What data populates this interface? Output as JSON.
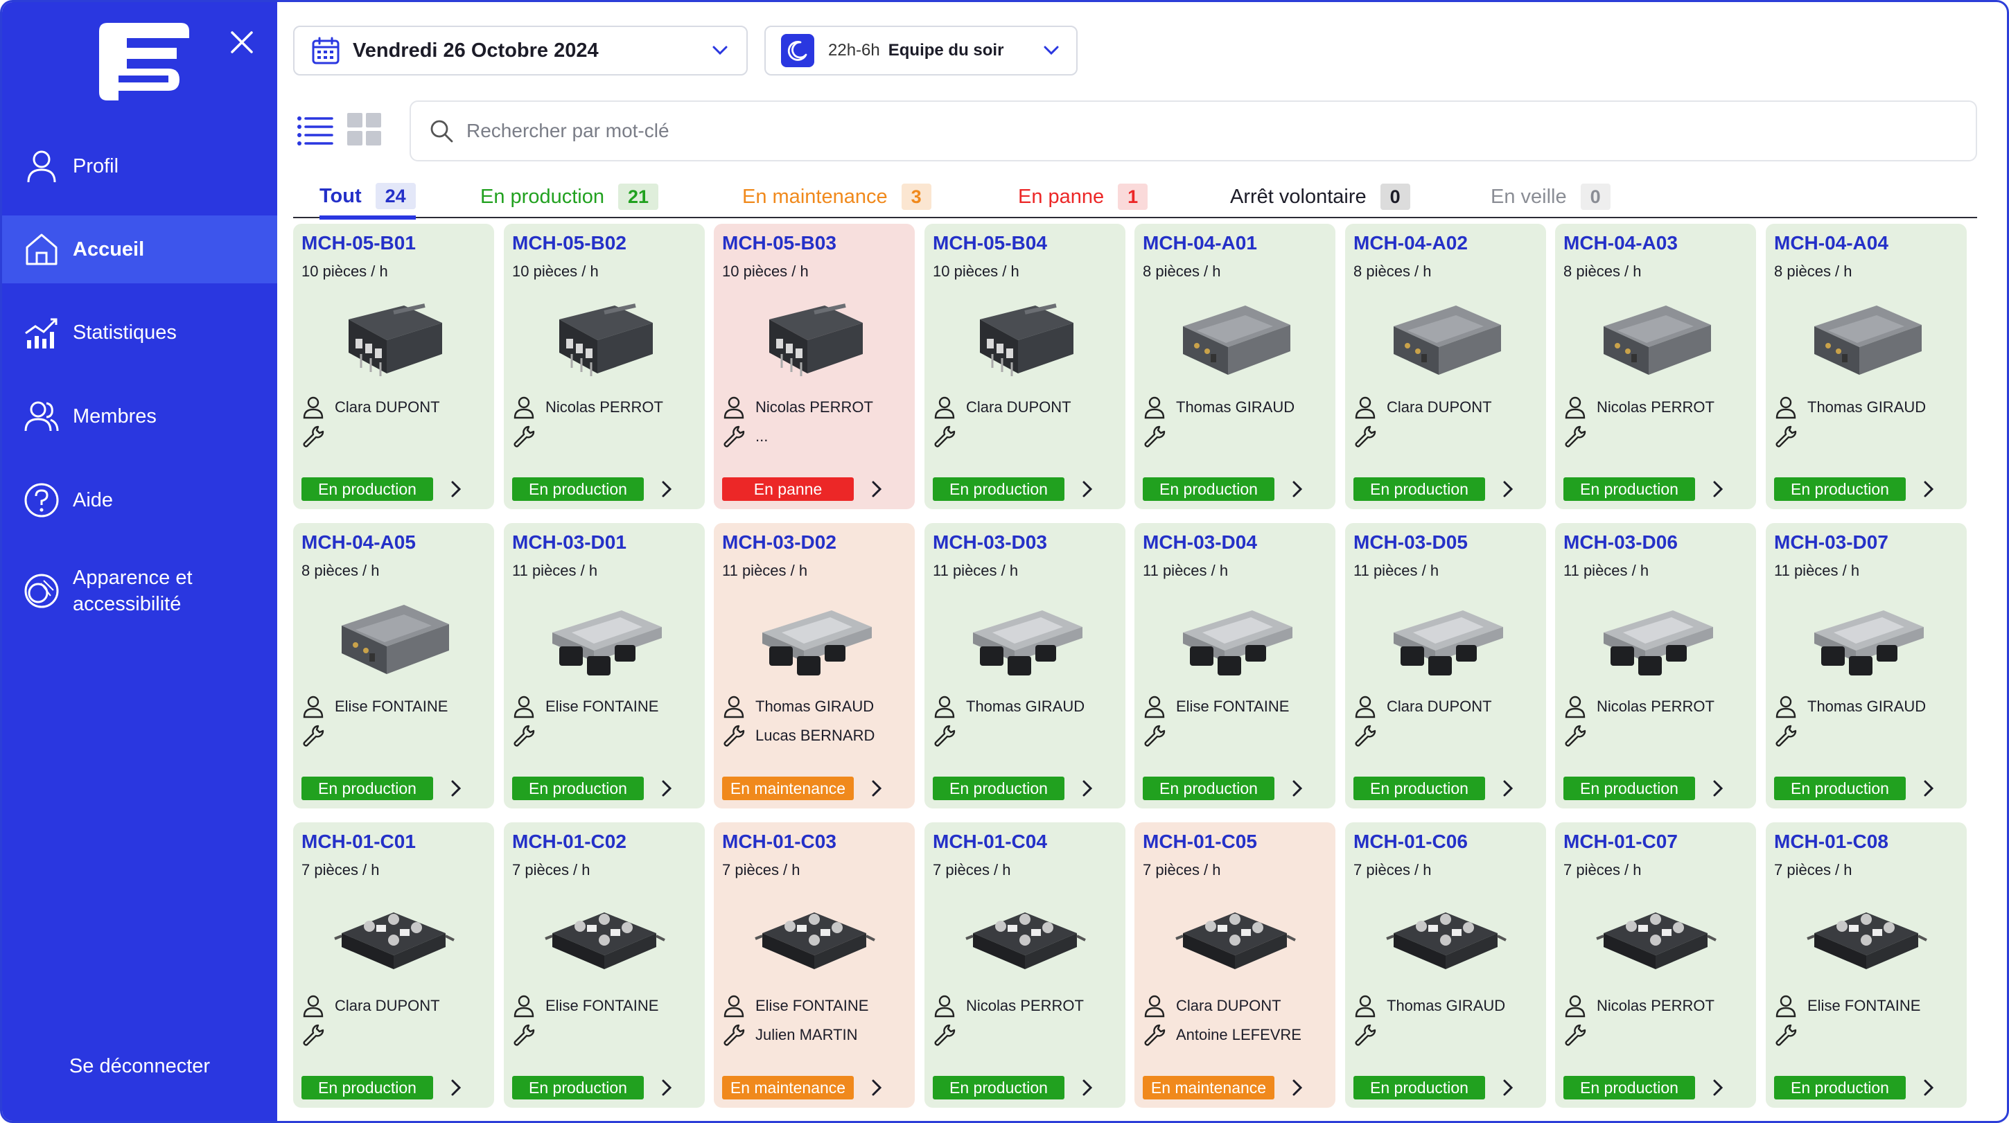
{
  "sidebar": {
    "logo": "logo-icon",
    "items": [
      {
        "label": "Profil",
        "icon": "user-icon"
      },
      {
        "label": "Accueil",
        "icon": "home-icon",
        "active": true
      },
      {
        "label": "Statistiques",
        "icon": "chart-icon"
      },
      {
        "label": "Membres",
        "icon": "members-icon"
      },
      {
        "label": "Aide",
        "icon": "help-icon"
      },
      {
        "label": "Apparence et accessibilité",
        "icon": "appearance-icon"
      }
    ],
    "logout": "Se déconnecter"
  },
  "header": {
    "date": "Vendredi 26 Octobre 2024",
    "shift_time": "22h-6h",
    "shift_name": "Equipe du soir"
  },
  "search": {
    "placeholder": "Rechercher par mot-clé"
  },
  "tabs": [
    {
      "label": "Tout",
      "count": "24",
      "color": "#2430c8",
      "badge": "#e3e7f8"
    },
    {
      "label": "En production",
      "count": "21",
      "color": "#21a11f",
      "badge": "#dfeedb"
    },
    {
      "label": "En maintenance",
      "count": "3",
      "color": "#f0891c",
      "badge": "#fbe6d1"
    },
    {
      "label": "En panne",
      "count": "1",
      "color": "#ec2727",
      "badge": "#fadada"
    },
    {
      "label": "Arrêt volontaire",
      "count": "0",
      "color": "#1c1c28",
      "badge": "#dcdcdc"
    },
    {
      "label": "En veille",
      "count": "0",
      "color": "#8a8d95",
      "badge": "#eeeeee"
    }
  ],
  "colors": {
    "sidebar": "#2a37e0",
    "production": "#21a11f",
    "panne": "#ec2727",
    "maintenance": "#f0891c",
    "link": "#2430c8"
  },
  "machines": [
    {
      "code": "MCH-05-B01",
      "rate": "10 pièces / h",
      "operator": "Clara DUPONT",
      "technician": "",
      "status": "En production",
      "kind": "prod",
      "img": "box"
    },
    {
      "code": "MCH-05-B02",
      "rate": "10 pièces / h",
      "operator": "Nicolas PERROT",
      "technician": "",
      "status": "En production",
      "kind": "prod",
      "img": "box"
    },
    {
      "code": "MCH-05-B03",
      "rate": "10 pièces / h",
      "operator": "Nicolas PERROT",
      "technician": "...",
      "status": "En panne",
      "kind": "panne",
      "img": "box"
    },
    {
      "code": "MCH-05-B04",
      "rate": "10 pièces / h",
      "operator": "Clara DUPONT",
      "technician": "",
      "status": "En production",
      "kind": "prod",
      "img": "box"
    },
    {
      "code": "MCH-04-A01",
      "rate": "8 pièces / h",
      "operator": "Thomas GIRAUD",
      "technician": "",
      "status": "En production",
      "kind": "prod",
      "img": "metal"
    },
    {
      "code": "MCH-04-A02",
      "rate": "8 pièces / h",
      "operator": "Clara DUPONT",
      "technician": "",
      "status": "En production",
      "kind": "prod",
      "img": "metal"
    },
    {
      "code": "MCH-04-A03",
      "rate": "8 pièces / h",
      "operator": "Nicolas PERROT",
      "technician": "",
      "status": "En production",
      "kind": "prod",
      "img": "metal"
    },
    {
      "code": "MCH-04-A04",
      "rate": "8 pièces / h",
      "operator": "Thomas GIRAUD",
      "technician": "",
      "status": "En production",
      "kind": "prod",
      "img": "metal"
    },
    {
      "code": "MCH-04-A05",
      "rate": "8 pièces / h",
      "operator": "Elise FONTAINE",
      "technician": "",
      "status": "En production",
      "kind": "prod",
      "img": "metal"
    },
    {
      "code": "MCH-03-D01",
      "rate": "11 pièces / h",
      "operator": "Elise FONTAINE",
      "technician": "",
      "status": "En production",
      "kind": "prod",
      "img": "ecu"
    },
    {
      "code": "MCH-03-D02",
      "rate": "11 pièces / h",
      "operator": "Thomas GIRAUD",
      "technician": "Lucas BERNARD",
      "status": "En maintenance",
      "kind": "maint",
      "img": "ecu"
    },
    {
      "code": "MCH-03-D03",
      "rate": "11 pièces / h",
      "operator": "Thomas GIRAUD",
      "technician": "",
      "status": "En production",
      "kind": "prod",
      "img": "ecu"
    },
    {
      "code": "MCH-03-D04",
      "rate": "11 pièces / h",
      "operator": "Elise FONTAINE",
      "technician": "",
      "status": "En production",
      "kind": "prod",
      "img": "ecu"
    },
    {
      "code": "MCH-03-D05",
      "rate": "11 pièces / h",
      "operator": "Clara DUPONT",
      "technician": "",
      "status": "En production",
      "kind": "prod",
      "img": "ecu"
    },
    {
      "code": "MCH-03-D06",
      "rate": "11 pièces / h",
      "operator": "Nicolas PERROT",
      "technician": "",
      "status": "En production",
      "kind": "prod",
      "img": "ecu"
    },
    {
      "code": "MCH-03-D07",
      "rate": "11 pièces / h",
      "operator": "Thomas GIRAUD",
      "technician": "",
      "status": "En production",
      "kind": "prod",
      "img": "ecu"
    },
    {
      "code": "MCH-01-C01",
      "rate": "7 pièces / h",
      "operator": "Clara DUPONT",
      "technician": "",
      "status": "En production",
      "kind": "prod",
      "img": "controller"
    },
    {
      "code": "MCH-01-C02",
      "rate": "7 pièces / h",
      "operator": "Elise FONTAINE",
      "technician": "",
      "status": "En production",
      "kind": "prod",
      "img": "controller"
    },
    {
      "code": "MCH-01-C03",
      "rate": "7 pièces / h",
      "operator": "Elise FONTAINE",
      "technician": "Julien MARTIN",
      "status": "En maintenance",
      "kind": "maint",
      "img": "controller"
    },
    {
      "code": "MCH-01-C04",
      "rate": "7 pièces / h",
      "operator": "Nicolas PERROT",
      "technician": "",
      "status": "En production",
      "kind": "prod",
      "img": "controller"
    },
    {
      "code": "MCH-01-C05",
      "rate": "7 pièces / h",
      "operator": "Clara DUPONT",
      "technician": "Antoine LEFEVRE",
      "status": "En maintenance",
      "kind": "maint",
      "img": "controller"
    },
    {
      "code": "MCH-01-C06",
      "rate": "7 pièces / h",
      "operator": "Thomas GIRAUD",
      "technician": "",
      "status": "En production",
      "kind": "prod",
      "img": "controller"
    },
    {
      "code": "MCH-01-C07",
      "rate": "7 pièces / h",
      "operator": "Nicolas PERROT",
      "technician": "",
      "status": "En production",
      "kind": "prod",
      "img": "controller"
    },
    {
      "code": "MCH-01-C08",
      "rate": "7 pièces / h",
      "operator": "Elise FONTAINE",
      "technician": "",
      "status": "En production",
      "kind": "prod",
      "img": "controller"
    }
  ]
}
